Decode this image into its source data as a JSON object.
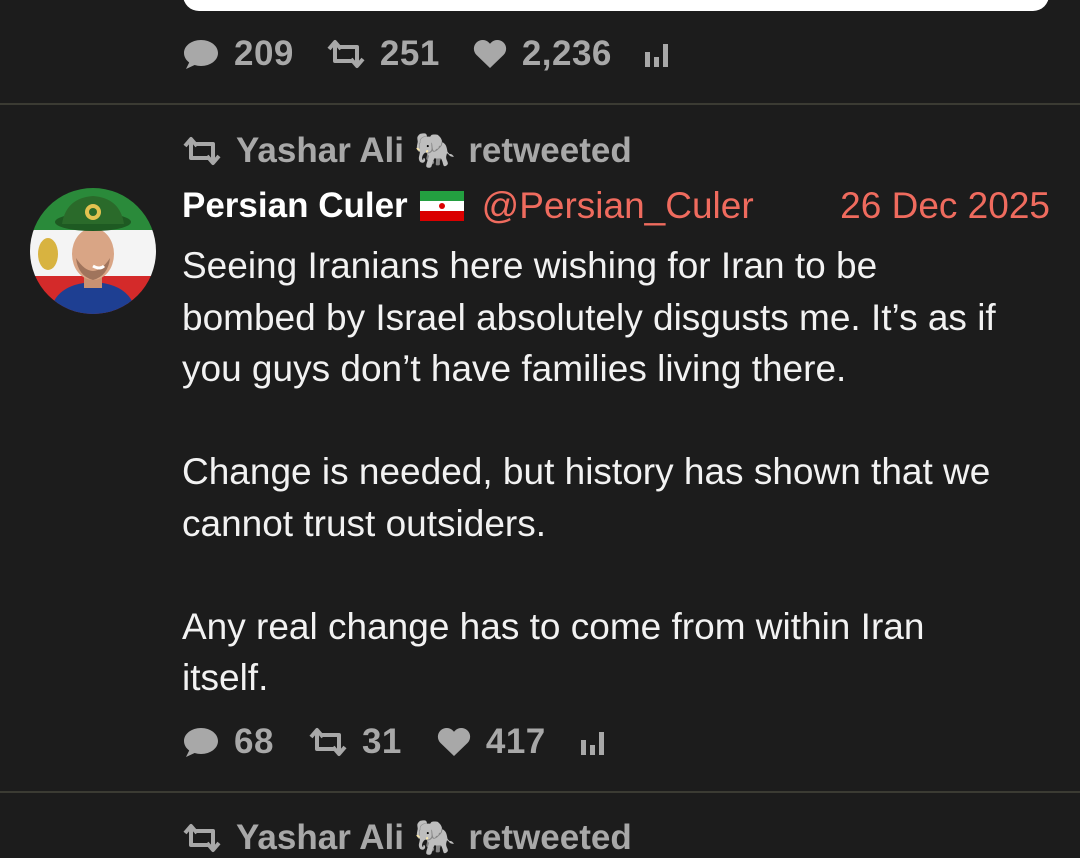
{
  "colors": {
    "background": "#1c1c1c",
    "divider": "#3b3b33",
    "muted": "#a8a8a8",
    "accent": "#ef6b5e",
    "text": "#f2f2f2"
  },
  "previous_tweet": {
    "stats": {
      "replies": "209",
      "retweets": "251",
      "likes": "2,236"
    }
  },
  "tweet": {
    "retweeted_by": "Yashar Ali",
    "retweeted_by_emoji": "🐘",
    "retweeted_label": "retweeted",
    "author_name": "Persian Culer",
    "author_flag_icon": "iran-flag-icon",
    "handle": "@Persian_Culer",
    "date": "26 Dec 2025",
    "paragraphs": [
      "Seeing Iranians here wishing for Iran to be\nbombed by Israel absolutely disgusts me. It’s as if\nyou guys don’t have families living there.",
      "Change is needed, but history has shown that we\ncannot trust outsiders.",
      "Any real change has to come from within Iran\nitself."
    ],
    "stats": {
      "replies": "68",
      "retweets": "31",
      "likes": "417"
    }
  },
  "next_tweet": {
    "retweeted_by": "Yashar Ali",
    "retweeted_by_emoji": "🐘",
    "retweeted_label": "retweeted"
  },
  "icons": {
    "reply": "speech-bubble-icon",
    "retweet": "retweet-icon",
    "like": "heart-icon",
    "analytics": "bar-chart-icon"
  }
}
